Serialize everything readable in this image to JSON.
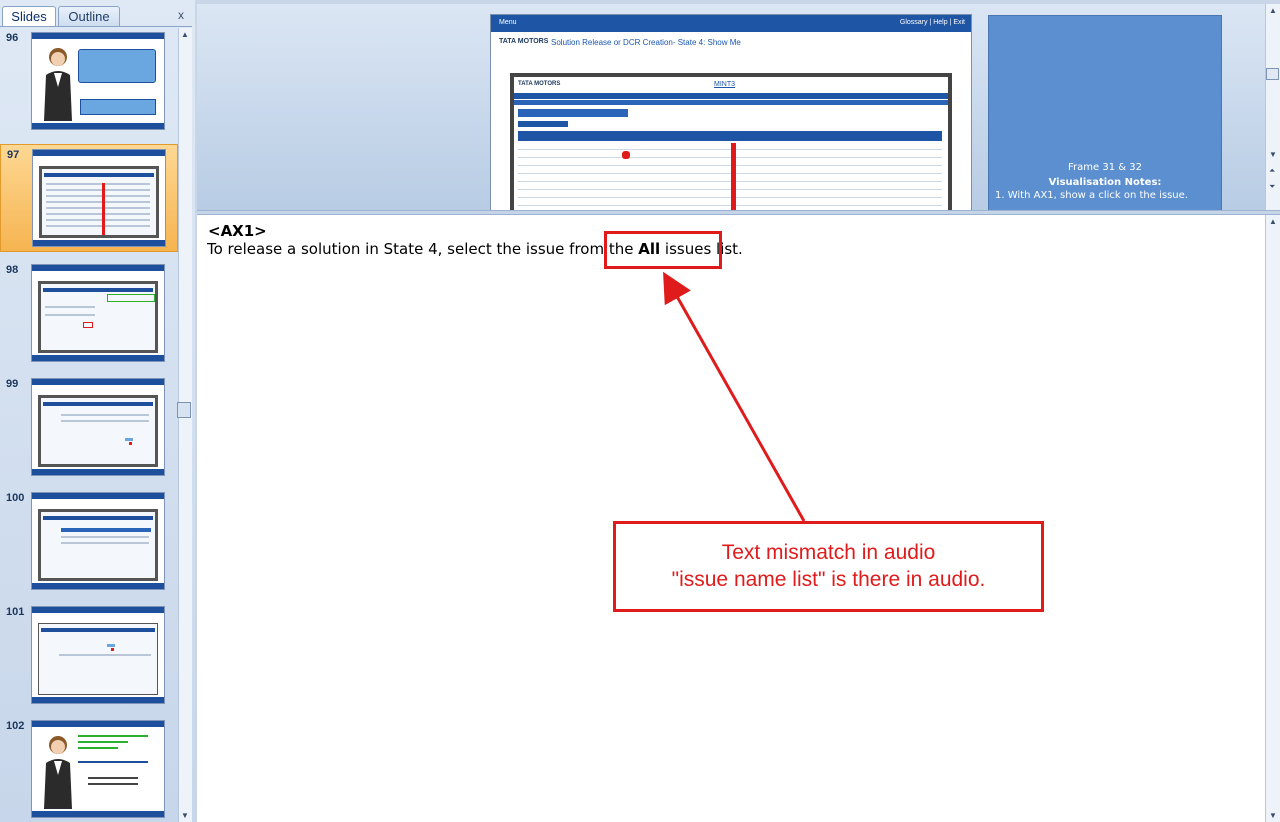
{
  "left_panel": {
    "tabs": [
      {
        "label": "Slides"
      },
      {
        "label": "Outline"
      }
    ],
    "close_glyph": "x",
    "slides": [
      {
        "number": "96",
        "selected": false
      },
      {
        "number": "97",
        "selected": true
      },
      {
        "number": "98",
        "selected": false
      },
      {
        "number": "99",
        "selected": false
      },
      {
        "number": "100",
        "selected": false
      },
      {
        "number": "101",
        "selected": false
      },
      {
        "number": "102",
        "selected": false
      }
    ]
  },
  "slide": {
    "menu_label": "Menu",
    "top_links": "Glossary | Help | Exit",
    "brand": "TATA MOTORS",
    "title": "Solution Release or DCR Creation- State 4: Show Me",
    "app_brand": "TATA MOTORS",
    "app_name": "MINT3"
  },
  "visual_notes": {
    "frame": "Frame 31 & 32",
    "heading": "Visualisation Notes:",
    "item": "1.   With AX1, show a click on the issue."
  },
  "notes": {
    "tag": "<AX1>",
    "text_before": "To release  a solution in State 4, select the issue  from the ",
    "text_bold": "All",
    "text_after": " issues  list."
  },
  "callout": {
    "line1": "Text mismatch in audio",
    "line2": "\"issue name list\" is there in audio."
  },
  "colors": {
    "annotation_red": "#e01b1b",
    "slide_blue": "#1f55a5",
    "selected_slide": "#f6b451"
  }
}
